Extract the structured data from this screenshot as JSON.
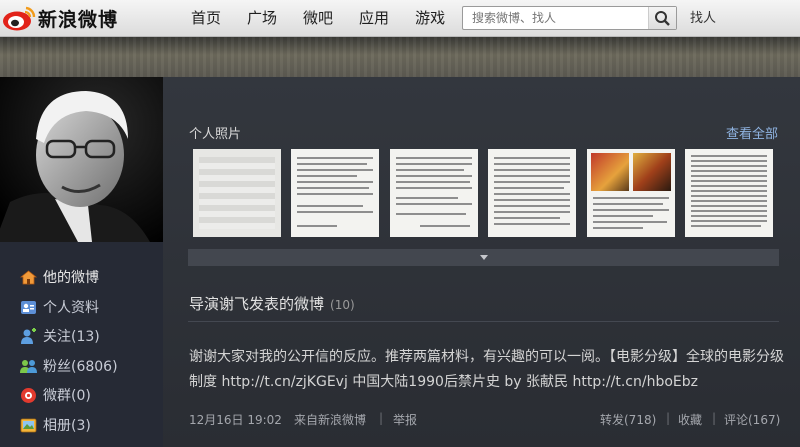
{
  "topbar": {
    "logo_text": "新浪微博",
    "nav": [
      "首页",
      "广场",
      "微吧",
      "应用",
      "游戏"
    ],
    "search_placeholder": "搜索微博、找人",
    "find_people": "找人"
  },
  "sidebar": {
    "items": [
      {
        "label": "他的微博",
        "icon": "home-icon"
      },
      {
        "label": "个人资料",
        "icon": "profile-icon"
      },
      {
        "label": "关注(13)",
        "icon": "follow-icon"
      },
      {
        "label": "粉丝(6806)",
        "icon": "fans-icon"
      },
      {
        "label": "微群(0)",
        "icon": "group-icon"
      },
      {
        "label": "相册(3)",
        "icon": "album-icon"
      }
    ]
  },
  "photos": {
    "title": "个人照片",
    "view_all": "查看全部"
  },
  "feed": {
    "title": "导演谢飞发表的微博",
    "count": "(10)",
    "post": {
      "text_1": "谢谢大家对我的公开信的反应。推荐两篇材料，有兴趣的可以一阅。【电影分级】全球的电影分级制度",
      "link_1": "http://t.cn/zjKGEvj",
      "text_2": "中国大陆1990后禁片史 by 张献民",
      "link_2": "http://t.cn/hboEbz",
      "time": "12月16日 19:02",
      "source": "来自新浪微博",
      "report": "举报",
      "repost": "转发(718)",
      "favorite": "收藏",
      "comment": "评论(167)"
    }
  }
}
